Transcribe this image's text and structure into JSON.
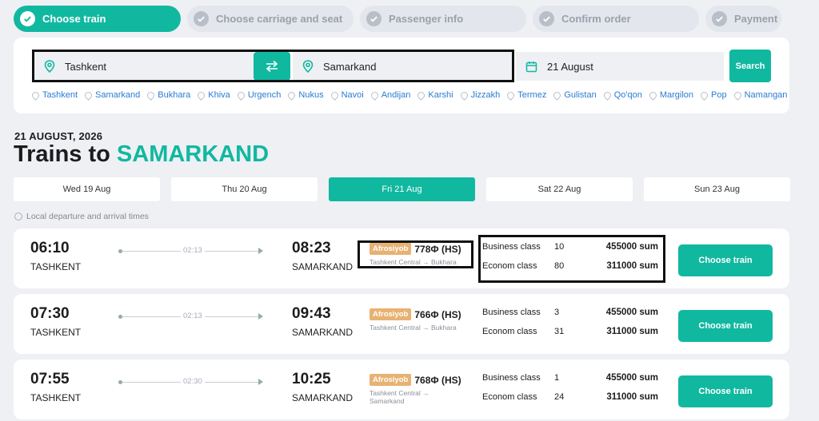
{
  "steps": [
    "Choose train",
    "Choose carriage and seat",
    "Passenger info",
    "Confirm order",
    "Payment"
  ],
  "search": {
    "from": "Tashkent",
    "to": "Samarkand",
    "date": "21 August",
    "button": "Search",
    "cities": [
      "Tashkent",
      "Samarkand",
      "Bukhara",
      "Khiva",
      "Urgench",
      "Nukus",
      "Navoi",
      "Andijan",
      "Karshi",
      "Jizzakh",
      "Termez",
      "Gulistan",
      "Qo'qon",
      "Margilon",
      "Pop",
      "Namangan"
    ]
  },
  "heading": {
    "date": "21 AUGUST, 2026",
    "prefix": "Trains to",
    "destination": "SAMARKAND"
  },
  "days": [
    "Wed 19 Aug",
    "Thu 20 Aug",
    "Fri 21 Aug",
    "Sat 22 Aug",
    "Sun 23 Aug"
  ],
  "local_note": "Local departure and arrival times",
  "trains": [
    {
      "dep_time": "06:10",
      "dep_city": "TASHKENT",
      "duration": "02:13",
      "arr_time": "08:23",
      "arr_city": "SAMARKAND",
      "brand": "Afrosiyob",
      "number": "778Ф (HS)",
      "route": "Tashkent Central → Bukhara",
      "classes": [
        {
          "name": "Business class",
          "seats": "10",
          "price": "455000 sum"
        },
        {
          "name": "Econom class",
          "seats": "80",
          "price": "311000 sum"
        }
      ],
      "button": "Choose train"
    },
    {
      "dep_time": "07:30",
      "dep_city": "TASHKENT",
      "duration": "02:13",
      "arr_time": "09:43",
      "arr_city": "SAMARKAND",
      "brand": "Afrosiyob",
      "number": "766Ф (HS)",
      "route": "Tashkent Central → Bukhara",
      "classes": [
        {
          "name": "Business class",
          "seats": "3",
          "price": "455000 sum"
        },
        {
          "name": "Econom class",
          "seats": "31",
          "price": "311000 sum"
        }
      ],
      "button": "Choose train"
    },
    {
      "dep_time": "07:55",
      "dep_city": "TASHKENT",
      "duration": "02:30",
      "arr_time": "10:25",
      "arr_city": "SAMARKAND",
      "brand": "Afrosiyob",
      "number": "768Ф (HS)",
      "route": "Tashkent Central → Samarkand",
      "classes": [
        {
          "name": "Business class",
          "seats": "1",
          "price": "455000 sum"
        },
        {
          "name": "Econom class",
          "seats": "24",
          "price": "311000 sum"
        }
      ],
      "button": "Choose train"
    }
  ],
  "colors": {
    "accent": "#11b8a0",
    "brand_badge": "#e8b273",
    "link": "#2b7bd3"
  }
}
